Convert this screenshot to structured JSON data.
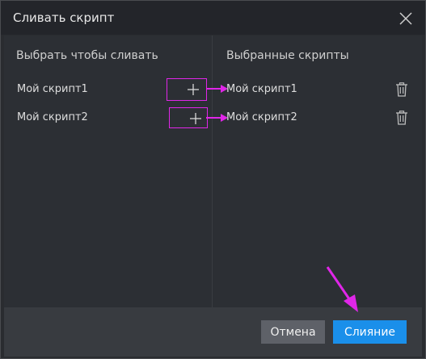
{
  "dialog": {
    "title": "Сливать скрипт",
    "close_icon": "close-icon"
  },
  "left_panel": {
    "heading": "Выбрать чтобы сливать",
    "items": [
      {
        "label": "Мой скрипт1",
        "action_icon": "plus-icon"
      },
      {
        "label": "Мой скрипт2",
        "action_icon": "plus-icon"
      }
    ]
  },
  "right_panel": {
    "heading": "Выбранные скрипты",
    "items": [
      {
        "label": "Мой скрипт1",
        "action_icon": "trash-icon"
      },
      {
        "label": "Мой скрипт2",
        "action_icon": "trash-icon"
      }
    ]
  },
  "footer": {
    "cancel_label": "Отмена",
    "merge_label": "Слияние"
  },
  "colors": {
    "accent": "#1a8fea",
    "annotation": "#e026e8"
  }
}
